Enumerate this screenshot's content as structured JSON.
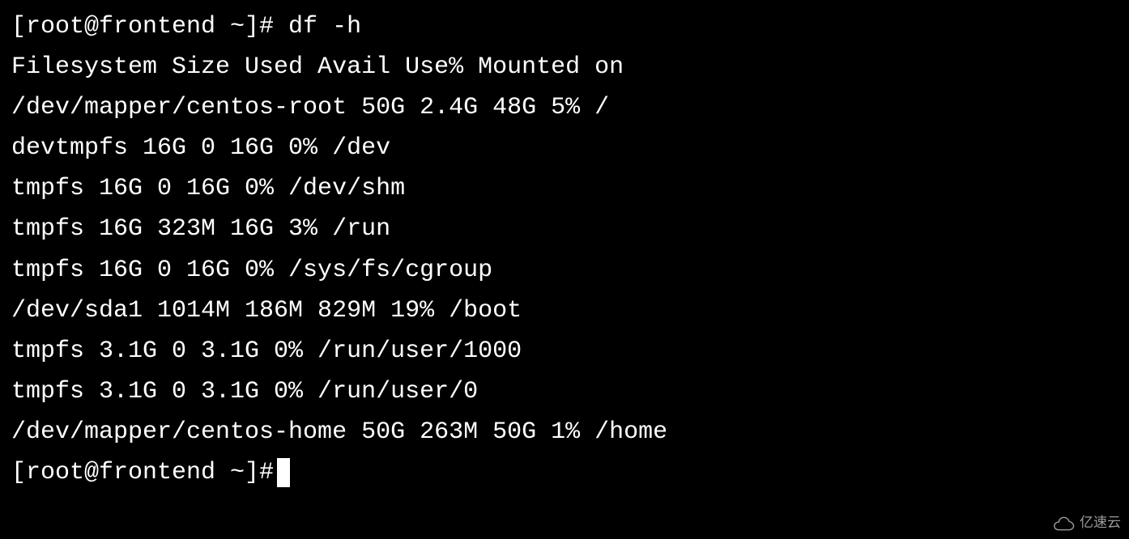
{
  "prompt1": "[root@frontend ~]# df -h",
  "header": {
    "filesystem": "Filesystem",
    "size": "Size",
    "used": "Used",
    "avail": "Avail",
    "usepct": "Use%",
    "mounted": "Mounted on"
  },
  "rows": [
    {
      "filesystem": "/dev/mapper/centos-root",
      "size": "50G",
      "used": "2.4G",
      "avail": "48G",
      "usepct": "5%",
      "mounted": "/"
    },
    {
      "filesystem": "devtmpfs",
      "size": "16G",
      "used": "0",
      "avail": "16G",
      "usepct": "0%",
      "mounted": "/dev"
    },
    {
      "filesystem": "tmpfs",
      "size": "16G",
      "used": "0",
      "avail": "16G",
      "usepct": "0%",
      "mounted": "/dev/shm"
    },
    {
      "filesystem": "tmpfs",
      "size": "16G",
      "used": "323M",
      "avail": "16G",
      "usepct": "3%",
      "mounted": "/run"
    },
    {
      "filesystem": "tmpfs",
      "size": "16G",
      "used": "0",
      "avail": "16G",
      "usepct": "0%",
      "mounted": "/sys/fs/cgroup"
    },
    {
      "filesystem": "/dev/sda1",
      "size": "1014M",
      "used": "186M",
      "avail": "829M",
      "usepct": "19%",
      "mounted": "/boot"
    },
    {
      "filesystem": "tmpfs",
      "size": "3.1G",
      "used": "0",
      "avail": "3.1G",
      "usepct": "0%",
      "mounted": "/run/user/1000"
    },
    {
      "filesystem": "tmpfs",
      "size": "3.1G",
      "used": "0",
      "avail": "3.1G",
      "usepct": "0%",
      "mounted": "/run/user/0"
    },
    {
      "filesystem": "/dev/mapper/centos-home",
      "size": "50G",
      "used": "263M",
      "avail": "50G",
      "usepct": "1%",
      "mounted": "/home"
    }
  ],
  "prompt2": "[root@frontend ~]# ",
  "watermark": "亿速云"
}
